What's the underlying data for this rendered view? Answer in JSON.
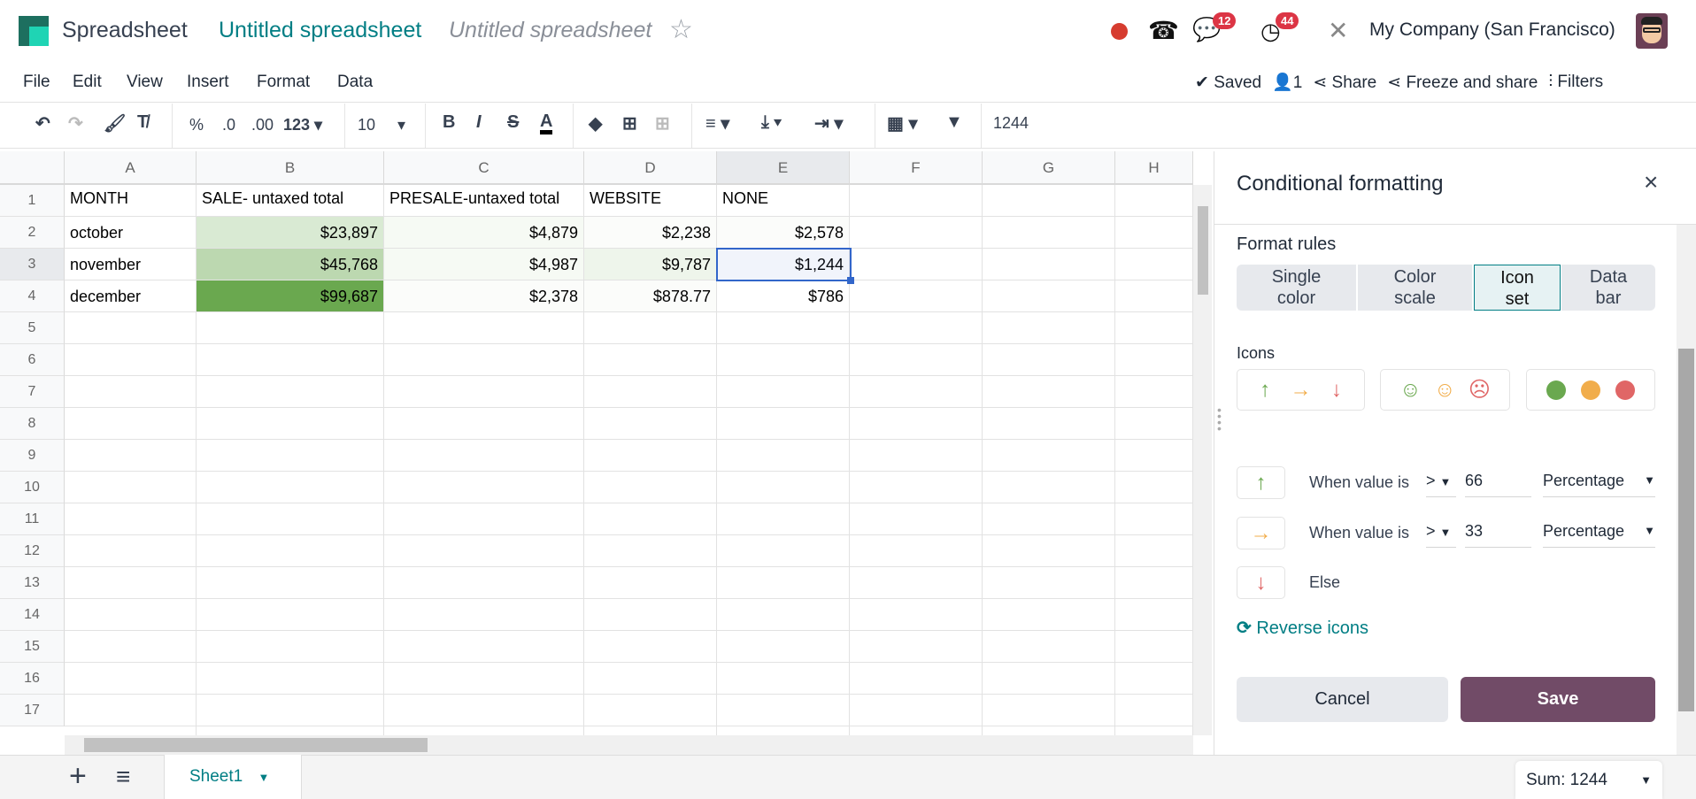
{
  "app": {
    "name": "Spreadsheet",
    "breadcrumb": "Untitled spreadsheet",
    "doc_name": "Untitled spreadsheet"
  },
  "systray": {
    "chat_count": "12",
    "activity_count": "44",
    "company": "My Company (San Francisco)"
  },
  "menu": [
    "File",
    "Edit",
    "View",
    "Insert",
    "Format",
    "Data"
  ],
  "status": {
    "saved": "Saved",
    "users": "1",
    "share": "Share",
    "freeze": "Freeze and share",
    "filters": "Filters"
  },
  "toolbar": {
    "percent": "%",
    "dec_less": ".0",
    "dec_more": ".00",
    "format": "123",
    "font_size": "10",
    "bold": "B",
    "italic": "I",
    "strike": "S",
    "text_color": "A"
  },
  "formula": "1244",
  "columns": [
    "A",
    "B",
    "C",
    "D",
    "E",
    "F",
    "G",
    "H"
  ],
  "rows": [
    [
      "MONTH",
      "SALE- untaxed total",
      "PRESALE-untaxed total",
      "WEBSITE",
      "NONE"
    ],
    [
      "october",
      "$23,897",
      "$4,879",
      "$2,238",
      "$2,578"
    ],
    [
      "november",
      "$45,768",
      "$4,987",
      "$9,787",
      "$1,244"
    ],
    [
      "december",
      "$99,687",
      "$2,378",
      "$878.77",
      "$786"
    ]
  ],
  "row_numbers": [
    "1",
    "2",
    "3",
    "4",
    "5",
    "6",
    "7",
    "8",
    "9",
    "10",
    "11",
    "12",
    "13",
    "14",
    "15",
    "16",
    "17"
  ],
  "selected_cell": "E3",
  "panel": {
    "title": "Conditional formatting",
    "format_rules": "Format rules",
    "tabs": [
      {
        "l1": "Single",
        "l2": "color"
      },
      {
        "l1": "Color",
        "l2": "scale"
      },
      {
        "l1": "Icon",
        "l2": "set"
      },
      {
        "l1": "Data",
        "l2": "bar"
      }
    ],
    "active_tab": "Icon set",
    "icons_label": "Icons",
    "rules": [
      {
        "label": "When value is",
        "operator": ">",
        "value": "66",
        "type": "Percentage"
      },
      {
        "label": "When value is",
        "operator": ">",
        "value": "33",
        "type": "Percentage"
      },
      {
        "label": "Else"
      }
    ],
    "reverse": "Reverse icons",
    "cancel": "Cancel",
    "save": "Save"
  },
  "colors": {
    "green": "#6aa84f",
    "orange": "#f1ad4b",
    "red": "#e06666",
    "teal": "#017e84",
    "save": "#714b67"
  },
  "bottom": {
    "sheet": "Sheet1",
    "sum": "Sum: 1244"
  }
}
